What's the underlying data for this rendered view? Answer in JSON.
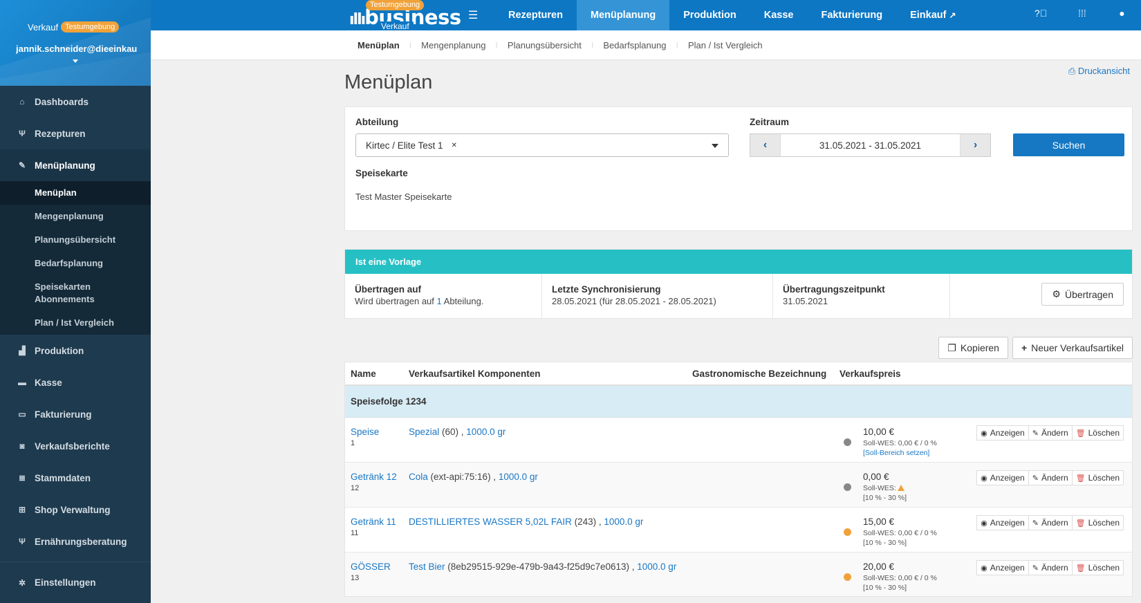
{
  "sidebar": {
    "role": "Verkauf",
    "env_badge": "Testumgebung",
    "user": "jannik.schneider@dieeinkau",
    "items": [
      {
        "label": "Dashboards",
        "icon": "home-icon"
      },
      {
        "label": "Rezepturen",
        "icon": "cutlery-icon"
      },
      {
        "label": "Menüplanung",
        "icon": "edit-icon"
      },
      {
        "label": "Produktion",
        "icon": "chart-icon"
      },
      {
        "label": "Kasse",
        "icon": "cash-register-icon"
      },
      {
        "label": "Fakturierung",
        "icon": "credit-card-icon"
      },
      {
        "label": "Verkaufsberichte",
        "icon": "money-icon"
      },
      {
        "label": "Stammdaten",
        "icon": "database-icon"
      },
      {
        "label": "Shop Verwaltung",
        "icon": "basket-icon"
      },
      {
        "label": "Ernährungsberatung",
        "icon": "cutlery-icon"
      }
    ],
    "sub_items": [
      "Menüplan",
      "Mengenplanung",
      "Planungsübersicht",
      "Bedarfsplanung",
      "Speisekarten Abonnements",
      "Plan / Ist Vergleich"
    ],
    "settings": "Einstellungen"
  },
  "topbar": {
    "logo_text": "business",
    "logo_badge": "Testumgebung",
    "logo_sub": "Verkauf",
    "nav": [
      "Rezepturen",
      "Menüplanung",
      "Produktion",
      "Kasse",
      "Fakturierung",
      "Einkauf"
    ]
  },
  "subnav": [
    "Menüplan",
    "Mengenplanung",
    "Planungsübersicht",
    "Bedarfsplanung",
    "Plan / Ist Vergleich"
  ],
  "page": {
    "title": "Menüplan",
    "print_label": "Druckansicht"
  },
  "filter": {
    "abteilung_label": "Abteilung",
    "abteilung_value": "Kirtec / Elite Test 1",
    "zeitraum_label": "Zeitraum",
    "zeitraum_value": "31.05.2021 - 31.05.2021",
    "search_label": "Suchen",
    "speisekarte_label": "Speisekarte",
    "speisekarte_value": "Test Master Speisekarte"
  },
  "template": {
    "header": "Ist eine Vorlage",
    "c1_h": "Übertragen auf",
    "c1_pre": "Wird übertragen auf ",
    "c1_num": "1",
    "c1_post": " Abteilung.",
    "c2_h": "Letzte Synchronisierung",
    "c2_v": "28.05.2021 (für 28.05.2021 - 28.05.2021)",
    "c3_h": "Übertragungszeitpunkt",
    "c3_v": "31.05.2021",
    "transfer_label": "Übertragen"
  },
  "actions": {
    "copy_label": "Kopieren",
    "new_label": "Neuer Verkaufsartikel"
  },
  "table": {
    "headers": [
      "Name",
      "Verkaufsartikel Komponenten",
      "Gastronomische Bezeichnung",
      "Verkaufspreis"
    ],
    "group": "Speisefolge 1234",
    "row_actions": [
      "Anzeigen",
      "Ändern",
      "Löschen"
    ],
    "rows": [
      {
        "name": "Speise",
        "nr": "1",
        "comp_name": "Spezial",
        "comp_extra": " (60) , ",
        "comp_qty": "1000.0 gr",
        "price": "10,00 €",
        "soll": "Soll-WES: 0,00 € / 0 %",
        "soll2": "[Soll-Bereich setzen]",
        "dot": "#888888"
      },
      {
        "name": "Getränk 12",
        "nr": "12",
        "comp_name": "Cola",
        "comp_extra": " (ext-api:75:16) , ",
        "comp_qty": "1000.0 gr",
        "price": "0,00 €",
        "soll": "Soll-WES:",
        "soll2": "[10 % - 30 %]",
        "dot": "#888888"
      },
      {
        "name": "Getränk 11",
        "nr": "11",
        "comp_name": "DESTILLIERTES WASSER 5,02L FAIR",
        "comp_extra": " (243) , ",
        "comp_qty": "1000.0 gr",
        "price": "15,00 €",
        "soll": "Soll-WES: 0,00 € / 0 %",
        "soll2": "[10 % - 30 %]",
        "dot": "#f0a23a"
      },
      {
        "name": "GÖSSER",
        "nr": "13",
        "comp_name": "Test Bier",
        "comp_extra": " (8eb29515-929e-479b-9a43-f25d9c7e0613) , ",
        "comp_qty": "1000.0 gr",
        "price": "20,00 €",
        "soll": "Soll-WES: 0,00 € / 0 %",
        "soll2": "[10 % - 30 %]",
        "dot": "#f0a23a"
      }
    ]
  }
}
